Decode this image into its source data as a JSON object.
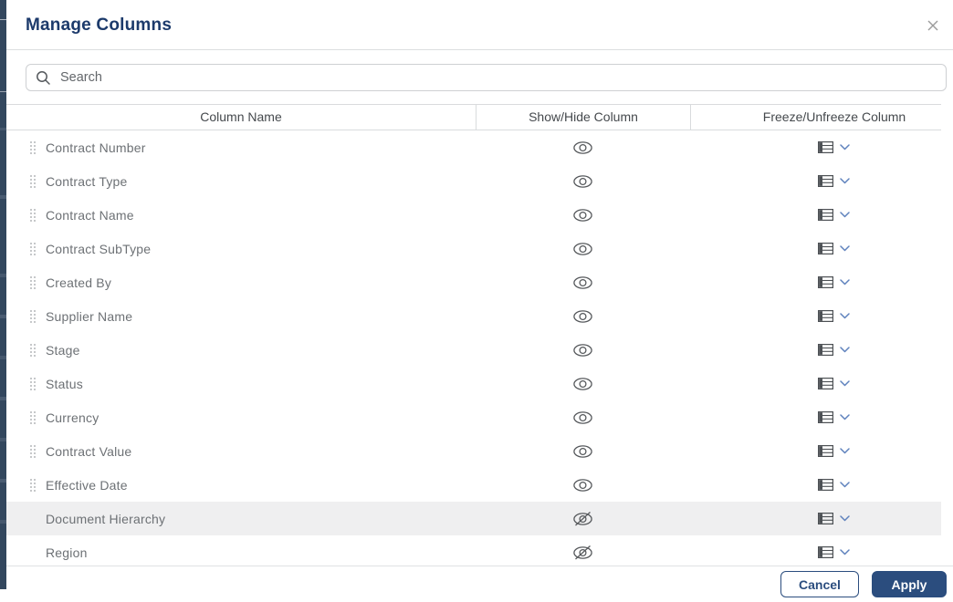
{
  "modal": {
    "title": "Manage Columns",
    "close_icon": "close-icon",
    "search": {
      "placeholder": "Search",
      "value": "",
      "icon": "search-icon"
    },
    "table": {
      "headers": [
        "Column Name",
        "Show/Hide Column",
        "Freeze/Unfreeze Column"
      ],
      "icons": {
        "visible": "eye-icon",
        "hidden": "eye-off-icon",
        "freeze": "freeze-table-icon",
        "dropdown": "chevron-down-icon",
        "drag": "drag-handle-icon"
      },
      "rows": [
        {
          "name": "Contract Number",
          "visible": true,
          "draggable": true,
          "highlighted": false
        },
        {
          "name": "Contract Type",
          "visible": true,
          "draggable": true,
          "highlighted": false
        },
        {
          "name": "Contract Name",
          "visible": true,
          "draggable": true,
          "highlighted": false
        },
        {
          "name": "Contract SubType",
          "visible": true,
          "draggable": true,
          "highlighted": false
        },
        {
          "name": "Created By",
          "visible": true,
          "draggable": true,
          "highlighted": false
        },
        {
          "name": "Supplier Name",
          "visible": true,
          "draggable": true,
          "highlighted": false
        },
        {
          "name": "Stage",
          "visible": true,
          "draggable": true,
          "highlighted": false
        },
        {
          "name": "Status",
          "visible": true,
          "draggable": true,
          "highlighted": false
        },
        {
          "name": "Currency",
          "visible": true,
          "draggable": true,
          "highlighted": false
        },
        {
          "name": "Contract Value",
          "visible": true,
          "draggable": true,
          "highlighted": false
        },
        {
          "name": "Effective Date",
          "visible": true,
          "draggable": true,
          "highlighted": false
        },
        {
          "name": "Document Hierarchy",
          "visible": false,
          "draggable": false,
          "highlighted": true
        },
        {
          "name": "Region",
          "visible": false,
          "draggable": false,
          "highlighted": false
        }
      ]
    },
    "footer": {
      "cancel_label": "Cancel",
      "apply_label": "Apply"
    },
    "colors": {
      "title_navy": "#1c3a6b",
      "button_navy": "#2b4d7e",
      "chevron_blue": "#5f82bd",
      "row_text_gray": "#6d7175",
      "row_highlight": "#efeff0",
      "page_edge_dark": "#33475e"
    }
  }
}
